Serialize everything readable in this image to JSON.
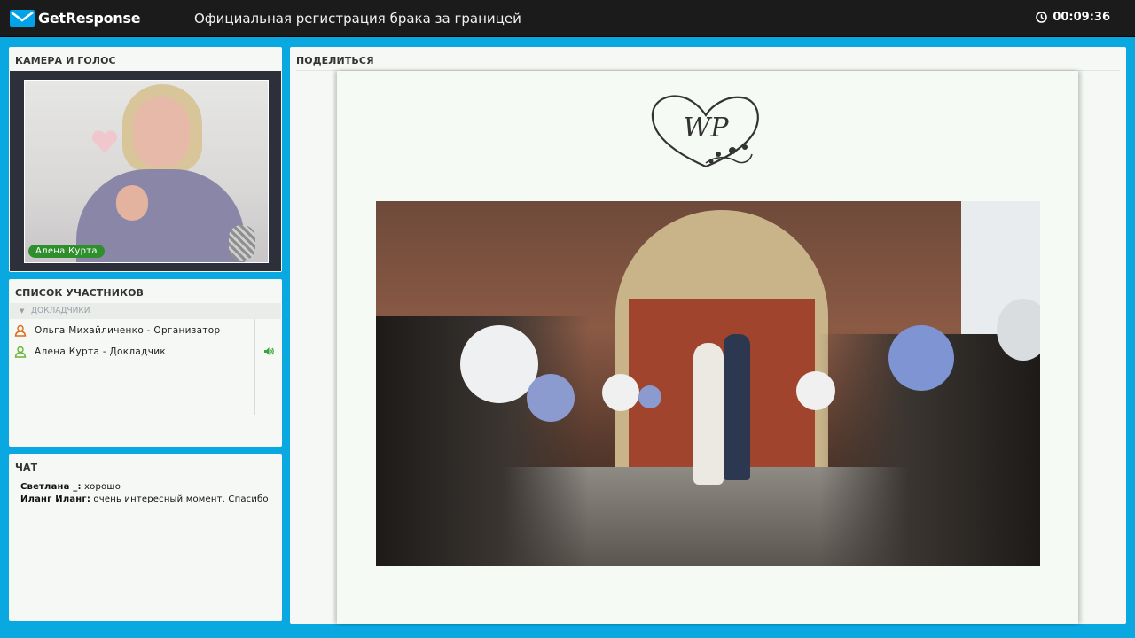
{
  "header": {
    "logo_text": "GetResponse",
    "webinar_title": "Официальная регистрация брака за границей",
    "timer": "00:09:36"
  },
  "camera": {
    "title": "КАМЕРА И ГОЛОС",
    "presenter_name": "Алена Курта"
  },
  "participants": {
    "title": "СПИСОК УЧАСТНИКОВ",
    "group_label": "ДОКЛАДЧИКИ",
    "items": [
      {
        "label": "Ольга Михайличенко  - Организатор",
        "icon_color": "#e06a1c"
      },
      {
        "label": "Алена Курта - Докладчик",
        "icon_color": "#6bb638"
      }
    ]
  },
  "chat": {
    "title": "ЧАТ",
    "messages": [
      {
        "author": "Светлана _:",
        "text": "хорошо"
      },
      {
        "author": "Иланг Иланг:",
        "text": "очень интересный момент. Спасибо"
      }
    ]
  },
  "share": {
    "title": "ПОДЕЛИТЬСЯ",
    "monogram": "WP"
  },
  "colors": {
    "topbar_bg": "#1b1b1b",
    "frame_bg": "#0aa8e0",
    "panel_bg": "#f5f8f4",
    "badge_green": "#2f8f2d"
  }
}
